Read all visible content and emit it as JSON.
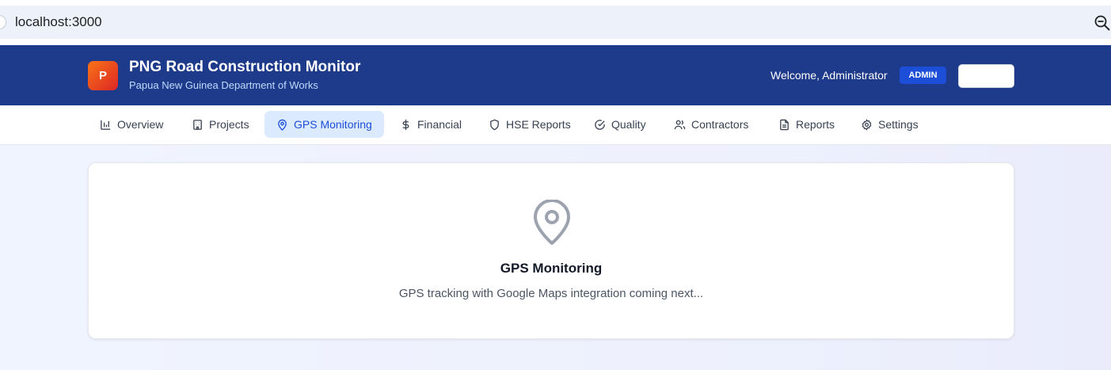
{
  "browser": {
    "url": "localhost:3000"
  },
  "header": {
    "logo_letter": "P",
    "title": "PNG Road Construction Monitor",
    "subtitle": "Papua New Guinea Department of Works",
    "welcome": "Welcome, Administrator",
    "role_badge": "ADMIN",
    "button_label": ""
  },
  "nav": {
    "tabs": [
      {
        "label": "Overview",
        "icon": "bar-chart-icon"
      },
      {
        "label": "Projects",
        "icon": "building-icon"
      },
      {
        "label": "GPS Monitoring",
        "icon": "map-pin-icon",
        "active": true
      },
      {
        "label": "Financial",
        "icon": "dollar-icon"
      },
      {
        "label": "HSE Reports",
        "icon": "shield-icon"
      },
      {
        "label": "Quality",
        "icon": "check-circle-icon"
      },
      {
        "label": "Contractors",
        "icon": "users-icon"
      },
      {
        "label": "Reports",
        "icon": "file-text-icon"
      },
      {
        "label": "Settings",
        "icon": "gear-icon"
      }
    ]
  },
  "main": {
    "card_title": "GPS Monitoring",
    "card_text": "GPS tracking with Google Maps integration coming next..."
  },
  "colors": {
    "header_bg": "#1e3a8a",
    "active_tab_bg": "#dbeafe",
    "active_tab_text": "#1d4ed8",
    "badge_bg": "#1d4ed8"
  }
}
